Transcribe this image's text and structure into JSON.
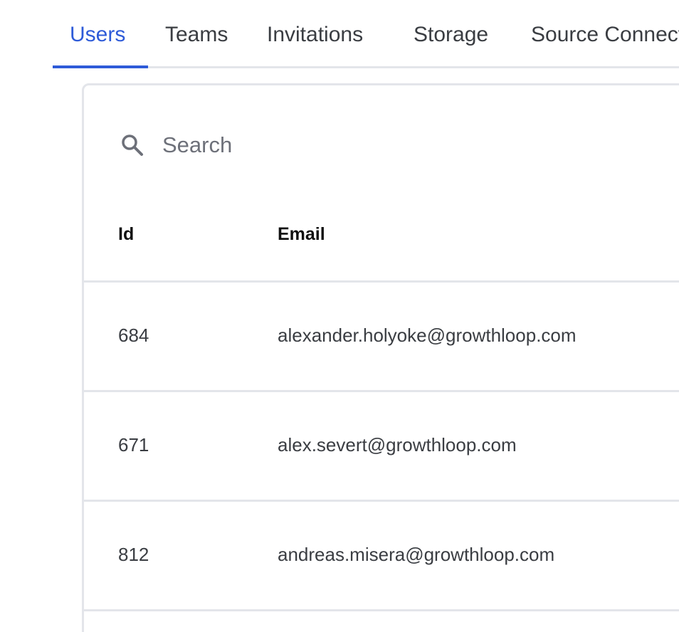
{
  "tabs": [
    {
      "label": "Users",
      "active": true
    },
    {
      "label": "Teams",
      "active": false
    },
    {
      "label": "Invitations",
      "active": false
    },
    {
      "label": "Storage",
      "active": false
    },
    {
      "label": "Source Connections",
      "active": false
    }
  ],
  "search": {
    "placeholder": "Search",
    "icon": "search-icon"
  },
  "table": {
    "columns": [
      "Id",
      "Email"
    ],
    "rows": [
      {
        "id": "684",
        "email": "alexander.holyoke@growthloop.com"
      },
      {
        "id": "671",
        "email": "alex.severt@growthloop.com"
      },
      {
        "id": "812",
        "email": "andreas.misera@growthloop.com"
      }
    ]
  },
  "colors": {
    "accent": "#2e5bd8",
    "text": "#3a3d42",
    "border": "#e3e5ea",
    "header_text": "#111111"
  }
}
